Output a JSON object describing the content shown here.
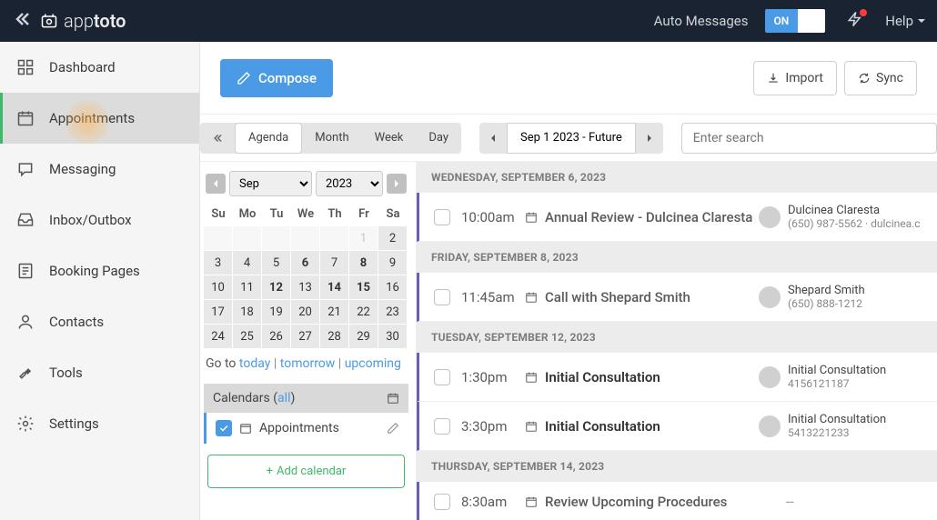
{
  "header": {
    "brand_prefix": "app",
    "brand_suffix": "toto",
    "auto_messages_label": "Auto Messages",
    "toggle_on": "ON",
    "help_label": "Help"
  },
  "sidebar": {
    "items": [
      {
        "label": "Dashboard"
      },
      {
        "label": "Appointments"
      },
      {
        "label": "Messaging"
      },
      {
        "label": "Inbox/Outbox"
      },
      {
        "label": "Booking Pages"
      },
      {
        "label": "Contacts"
      },
      {
        "label": "Tools"
      },
      {
        "label": "Settings"
      }
    ]
  },
  "toolbar": {
    "compose_label": "Compose",
    "import_label": "Import",
    "sync_label": "Sync"
  },
  "views": {
    "agenda": "Agenda",
    "month": "Month",
    "week": "Week",
    "day": "Day"
  },
  "date_nav": {
    "range_label": "Sep 1 2023 - Future"
  },
  "search": {
    "placeholder": "Enter search"
  },
  "mini_cal": {
    "month": "Sep",
    "year": "2023",
    "day_headers": [
      "Su",
      "Mo",
      "Tu",
      "We",
      "Th",
      "Fr",
      "Sa"
    ],
    "rows": [
      [
        {
          "d": "",
          "o": true
        },
        {
          "d": "",
          "o": true
        },
        {
          "d": "",
          "o": true
        },
        {
          "d": "",
          "o": true
        },
        {
          "d": "",
          "o": true
        },
        {
          "d": "1",
          "o": true,
          "g": true
        },
        {
          "d": "2"
        }
      ],
      [
        {
          "d": "3"
        },
        {
          "d": "4"
        },
        {
          "d": "5"
        },
        {
          "d": "6",
          "b": true
        },
        {
          "d": "7"
        },
        {
          "d": "8",
          "b": true
        },
        {
          "d": "9"
        }
      ],
      [
        {
          "d": "10"
        },
        {
          "d": "11"
        },
        {
          "d": "12",
          "b": true
        },
        {
          "d": "13"
        },
        {
          "d": "14",
          "b": true
        },
        {
          "d": "15",
          "b": true
        },
        {
          "d": "16"
        }
      ],
      [
        {
          "d": "17"
        },
        {
          "d": "18"
        },
        {
          "d": "19"
        },
        {
          "d": "20"
        },
        {
          "d": "21"
        },
        {
          "d": "22"
        },
        {
          "d": "23"
        }
      ],
      [
        {
          "d": "24"
        },
        {
          "d": "25"
        },
        {
          "d": "26"
        },
        {
          "d": "27"
        },
        {
          "d": "28"
        },
        {
          "d": "29"
        },
        {
          "d": "30"
        }
      ]
    ]
  },
  "goto": {
    "prefix": "Go to ",
    "today": "today",
    "tomorrow": "tomorrow",
    "upcoming": "upcoming"
  },
  "calendars": {
    "header_prefix": "Calendars ( ",
    "all_label": "all",
    "header_suffix": " )",
    "item_label": "Appointments",
    "add_label": "Add calendar"
  },
  "agenda": {
    "days": [
      {
        "header": "WEDNESDAY, SEPTEMBER 6, 2023",
        "rows": [
          {
            "time": "10:00am",
            "title": "Annual Review - Dulcinea Claresta",
            "bold": false,
            "contact_name": "Dulcinea Claresta",
            "contact_phone": "(650) 987-5562 · dulcinea.c"
          }
        ]
      },
      {
        "header": "FRIDAY, SEPTEMBER 8, 2023",
        "rows": [
          {
            "time": "11:45am",
            "title": "Call with Shepard Smith",
            "bold": false,
            "contact_name": "Shepard Smith",
            "contact_phone": "(650) 888-1212"
          }
        ]
      },
      {
        "header": "TUESDAY, SEPTEMBER 12, 2023",
        "rows": [
          {
            "time": "1:30pm",
            "title": "Initial Consultation",
            "bold": true,
            "contact_name": "Initial Consultation",
            "contact_phone": "4156121187"
          },
          {
            "time": "3:30pm",
            "title": "Initial Consultation",
            "bold": true,
            "contact_name": "Initial Consultation",
            "contact_phone": "5413221233"
          }
        ]
      },
      {
        "header": "THURSDAY, SEPTEMBER 14, 2023",
        "rows": [
          {
            "time": "8:30am",
            "title": "Review Upcoming Procedures",
            "bold": false,
            "dash": "--"
          }
        ]
      }
    ]
  }
}
